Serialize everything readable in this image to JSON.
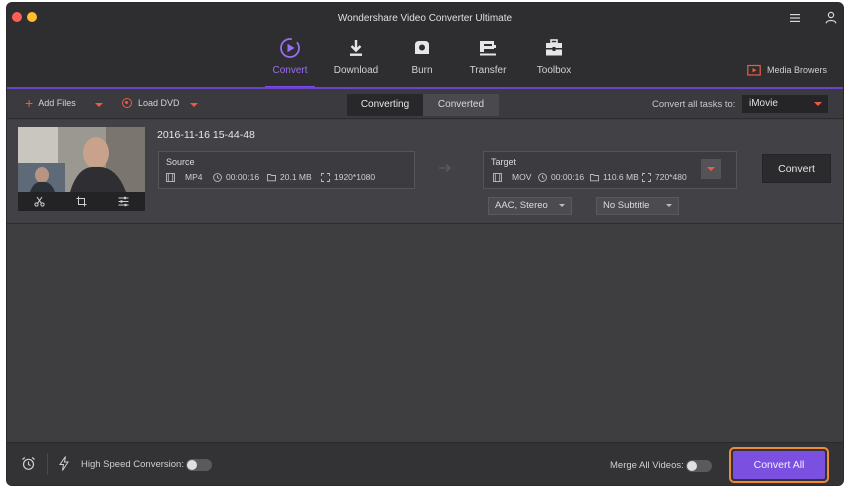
{
  "window": {
    "title": "Wondershare Video Converter Ultimate"
  },
  "nav": {
    "items": [
      {
        "label": "Convert",
        "icon": "convert-icon",
        "active": true
      },
      {
        "label": "Download",
        "icon": "download-icon",
        "active": false
      },
      {
        "label": "Burn",
        "icon": "burn-icon",
        "active": false
      },
      {
        "label": "Transfer",
        "icon": "transfer-icon",
        "active": false
      },
      {
        "label": "Toolbox",
        "icon": "toolbox-icon",
        "active": false
      }
    ],
    "media_browser": "Media Browers"
  },
  "actionbar": {
    "add_files": "Add Files",
    "load_dvd": "Load DVD",
    "tabs": [
      "Converting",
      "Converted"
    ],
    "active_tab": "Converting",
    "convert_all_label": "Convert all tasks to:",
    "convert_all_value": "iMovie"
  },
  "item": {
    "name": "2016-11-16 15-44-48",
    "source": {
      "title": "Source",
      "format": "MP4",
      "duration": "00:00:16",
      "size": "20.1 MB",
      "resolution": "1920*1080"
    },
    "target": {
      "title": "Target",
      "format": "MOV",
      "duration": "00:00:16",
      "size": "110.6 MB",
      "resolution": "720*480"
    },
    "convert_button": "Convert",
    "audio": "AAC, Stereo",
    "subtitle": "No Subtitle"
  },
  "bottombar": {
    "high_speed_label": "High Speed Conversion:",
    "merge_label": "Merge All Videos:",
    "convert_all_button": "Convert All"
  },
  "colors": {
    "accent": "#7b4fe0",
    "highlight": "#ee8b3a",
    "dropdown_caret": "#ef5a43"
  }
}
